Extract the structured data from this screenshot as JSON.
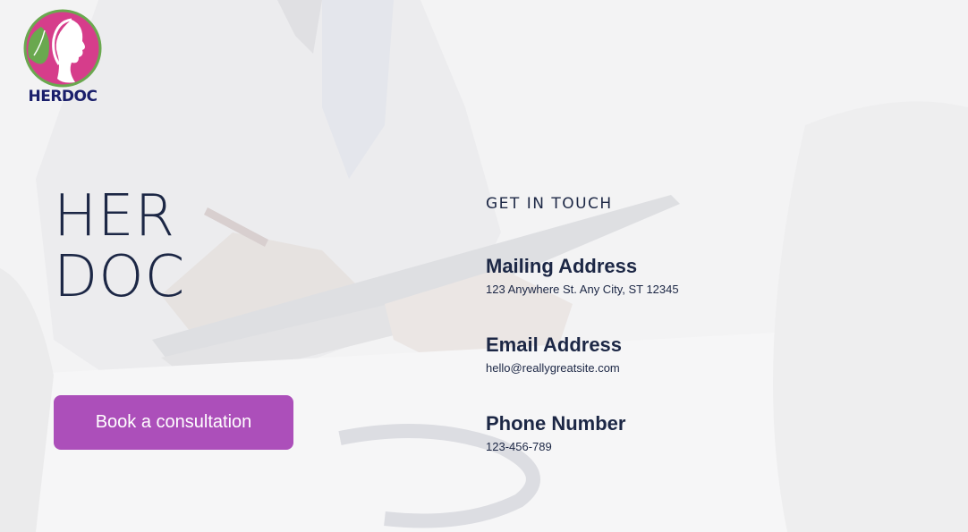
{
  "logo": {
    "text": "HERDOC",
    "icon": "woman-profile-leaf-logo",
    "colors": {
      "circle": "#d63d8b",
      "leaf": "#6aa84f",
      "text": "#1a1f6b"
    }
  },
  "hero": {
    "title_line1": "HER",
    "title_line2": "DOC"
  },
  "cta": {
    "label": "Book a consultation",
    "color": "#ac4fba"
  },
  "contact": {
    "heading": "GET IN TOUCH",
    "items": [
      {
        "label": "Mailing Address",
        "value": "123 Anywhere St. Any City, ST 12345"
      },
      {
        "label": "Email Address",
        "value": "hello@reallygreatsite.com"
      },
      {
        "label": "Phone Number",
        "value": "123-456-789"
      }
    ]
  },
  "colors": {
    "text": "#1c2745",
    "accent": "#ac4fba"
  }
}
